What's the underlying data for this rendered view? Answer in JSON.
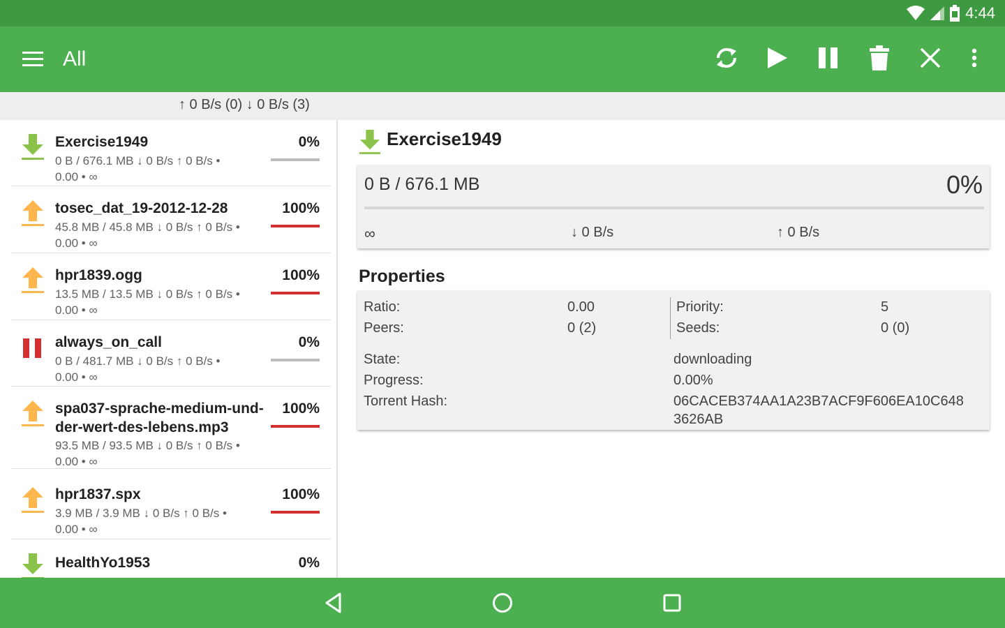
{
  "status_bar": {
    "time": "4:44"
  },
  "toolbar": {
    "title": "All",
    "actions": [
      "refresh-icon",
      "play-icon",
      "pause-icon",
      "delete-icon",
      "close-icon",
      "more-vert-icon"
    ]
  },
  "speed_summary": "↑ 0 B/s (0)  ↓ 0 B/s (3)",
  "colors": {
    "primary": "#4caf50",
    "primary_dark": "#3e9a41",
    "download_icon": "#8bc34a",
    "upload_icon": "#ffb74d",
    "paused_icon": "#d32f2f",
    "progress_complete": "#d32f2f",
    "progress_empty": "#bdbdbd"
  },
  "torrents": [
    {
      "name": "Exercise1949",
      "percent": "0%",
      "progress": 0.0,
      "sizes": "0 B / 676.1 MB ↓ 0 B/s ↑ 0 B/s •",
      "ratio_eta": "0.00 • ∞",
      "icon": "download-arrow-icon"
    },
    {
      "name": "tosec_dat_19-2012-12-28",
      "percent": "100%",
      "progress": 1.0,
      "sizes": "45.8 MB / 45.8 MB ↓ 0 B/s ↑ 0 B/s •",
      "ratio_eta": "0.00 • ∞",
      "icon": "upload-arrow-icon"
    },
    {
      "name": "hpr1839.ogg",
      "percent": "100%",
      "progress": 1.0,
      "sizes": "13.5 MB / 13.5 MB ↓ 0 B/s ↑ 0 B/s •",
      "ratio_eta": "0.00 • ∞",
      "icon": "upload-arrow-icon"
    },
    {
      "name": "always_on_call",
      "percent": "0%",
      "progress": 0.0,
      "sizes": "0 B / 481.7 MB ↓ 0 B/s ↑ 0 B/s •",
      "ratio_eta": "0.00 • ∞",
      "icon": "pause-state-icon"
    },
    {
      "name": "spa037-sprache-medium-und-",
      "name_line2": "der-wert-des-lebens.mp3",
      "percent": "100%",
      "progress": 1.0,
      "sizes": "93.5 MB / 93.5 MB ↓ 0 B/s ↑ 0 B/s •",
      "ratio_eta": "0.00 • ∞",
      "icon": "upload-arrow-icon"
    },
    {
      "name": "hpr1837.spx",
      "percent": "100%",
      "progress": 1.0,
      "sizes": "3.9 MB / 3.9 MB ↓ 0 B/s ↑ 0 B/s •",
      "ratio_eta": "0.00 • ∞",
      "icon": "upload-arrow-icon"
    },
    {
      "name": "HealthYo1953",
      "percent": "0%",
      "progress": 0.0,
      "sizes": "",
      "ratio_eta": "",
      "icon": "download-arrow-icon"
    }
  ],
  "detail": {
    "title": "Exercise1949",
    "size_progress": "0 B / 676.1 MB",
    "percent": "0%",
    "progress": 0.0,
    "eta": "∞",
    "down_speed": "↓ 0 B/s",
    "up_speed": "↑ 0 B/s",
    "properties_heading": "Properties",
    "ratio_label": "Ratio:",
    "ratio_value": "0.00",
    "peers_label": "Peers:",
    "peers_value": "0 (2)",
    "priority_label": "Priority:",
    "priority_value": "5",
    "seeds_label": "Seeds:",
    "seeds_value": "0 (0)",
    "state_label": "State:",
    "state_value": "downloading",
    "progress_label": "Progress:",
    "progress_value": "0.00%",
    "hash_label": "Torrent Hash:",
    "hash_line1": "06CACEB374AA1A23B7ACF9F606EA10C648",
    "hash_line2": "3626AB"
  },
  "nav_bar": [
    "back-icon",
    "home-icon",
    "recents-icon"
  ]
}
